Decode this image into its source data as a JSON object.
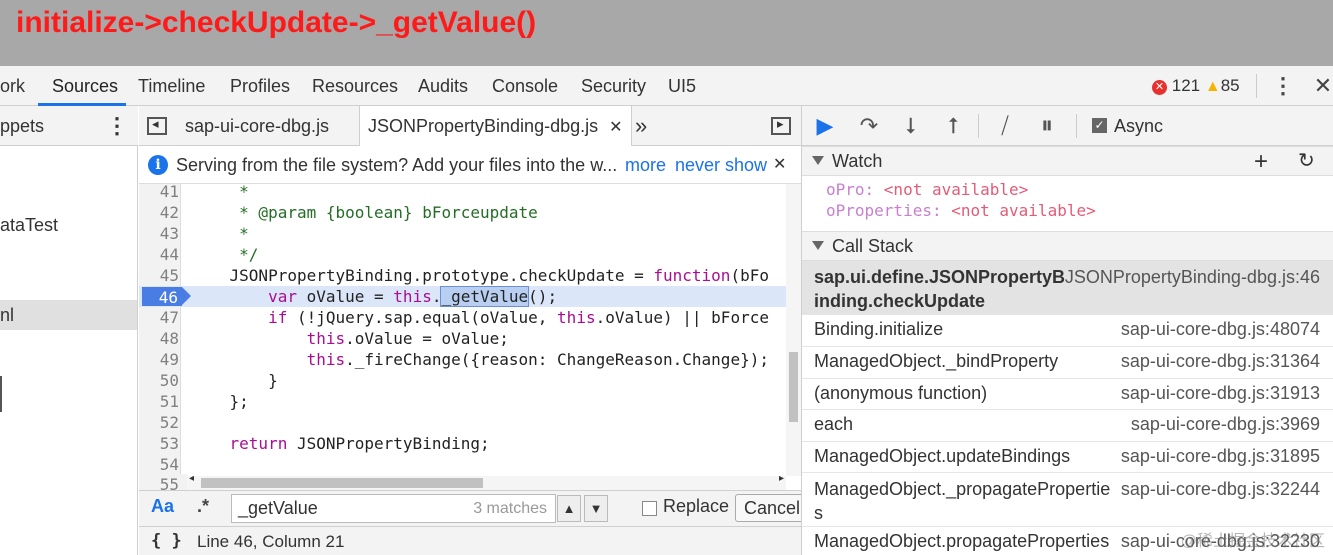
{
  "banner": {
    "title": "initialize->checkUpdate->_getValue()"
  },
  "tabs": [
    "ork",
    "Sources",
    "Timeline",
    "Profiles",
    "Resources",
    "Audits",
    "Console",
    "Security",
    "UI5"
  ],
  "active_tab": "Sources",
  "counts": {
    "errors": "121",
    "warnings": "85"
  },
  "left_panel": {
    "header": "ppets",
    "items": [
      "ataTest",
      "nl"
    ]
  },
  "editor": {
    "tabs": [
      {
        "label": "sap-ui-core-dbg.js"
      },
      {
        "label": "JSONPropertyBinding-dbg.js"
      }
    ],
    "infobar": {
      "message": "Serving from the file system? Add your files into the w...",
      "more": "more",
      "never_show": "never show"
    },
    "lines": [
      {
        "n": "41",
        "code": "     *"
      },
      {
        "n": "42",
        "code": "     * @param {boolean} bForceupdate"
      },
      {
        "n": "43",
        "code": "     *"
      },
      {
        "n": "44",
        "code": "     */"
      },
      {
        "n": "45",
        "code": "    JSONPropertyBinding.prototype.checkUpdate = function(bFo"
      },
      {
        "n": "46",
        "code": "        var oValue = this._getValue();"
      },
      {
        "n": "47",
        "code": "        if (!jQuery.sap.equal(oValue, this.oValue) || bForce"
      },
      {
        "n": "48",
        "code": "            this.oValue = oValue;"
      },
      {
        "n": "49",
        "code": "            this._fireChange({reason: ChangeReason.Change});"
      },
      {
        "n": "50",
        "code": "        }"
      },
      {
        "n": "51",
        "code": "    };"
      },
      {
        "n": "52",
        "code": ""
      },
      {
        "n": "53",
        "code": "    return JSONPropertyBinding;"
      },
      {
        "n": "54",
        "code": ""
      },
      {
        "n": "55",
        "code": ""
      }
    ],
    "execution_line": "46",
    "find": {
      "aa": "Aa",
      "regex": ".*",
      "query": "_getValue",
      "matches": "3 matches",
      "replace_label": "Replace",
      "cancel_label": "Cancel"
    },
    "status": {
      "braces": "{ }",
      "position": "Line 46, Column 21"
    }
  },
  "debugger": {
    "async_label": "Async",
    "watch": {
      "title": "Watch",
      "items": [
        {
          "name": "oPro",
          "value": "<not available>"
        },
        {
          "name": "oProperties",
          "value": "<not available>"
        }
      ]
    },
    "call_stack": {
      "title": "Call Stack",
      "frames": [
        {
          "fn_line1": "sap.ui.define.JSONPropertyB",
          "fn_line2": "inding.checkUpdate",
          "loc": "JSONPropertyBinding-dbg.js:46"
        },
        {
          "fn_line1": "Binding.initialize",
          "fn_line2": "",
          "loc": "sap-ui-core-dbg.js:48074"
        },
        {
          "fn_line1": "ManagedObject._bindProperty",
          "fn_line2": "",
          "loc": "sap-ui-core-dbg.js:31364"
        },
        {
          "fn_line1": "(anonymous function)",
          "fn_line2": "",
          "loc": "sap-ui-core-dbg.js:31913"
        },
        {
          "fn_line1": "each",
          "fn_line2": "",
          "loc": "sap-ui-core-dbg.js:3969"
        },
        {
          "fn_line1": "ManagedObject.updateBindings",
          "fn_line2": "",
          "loc": "sap-ui-core-dbg.js:31895"
        },
        {
          "fn_line1": "ManagedObject._propagatePropertie",
          "fn_line2": "s",
          "loc": "sap-ui-core-dbg.js:32244"
        },
        {
          "fn_line1": "ManagedObject.propagateProperties",
          "fn_line2": "",
          "loc": "sap-ui-core-dbg.js:32230"
        }
      ]
    }
  },
  "watermark": "@稀土掘金技术社区"
}
